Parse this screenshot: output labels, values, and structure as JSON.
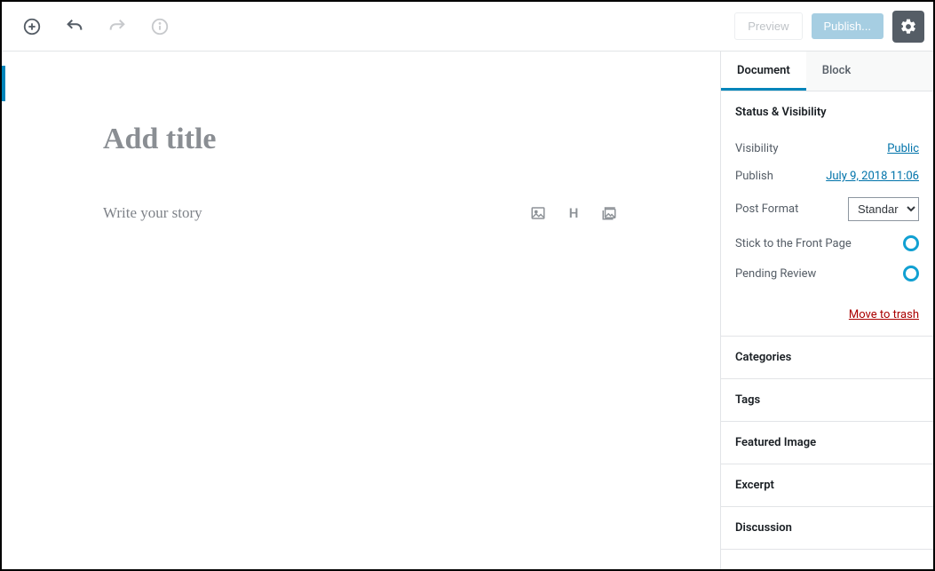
{
  "toolbar": {
    "preview_label": "Preview",
    "publish_label": "Publish..."
  },
  "editor": {
    "title_placeholder": "Add title",
    "body_placeholder": "Write your story",
    "heading_shortcut": "H"
  },
  "sidebar": {
    "tabs": {
      "document": "Document",
      "block": "Block",
      "active": "document"
    },
    "status_panel": {
      "heading": "Status & Visibility",
      "visibility_label": "Visibility",
      "visibility_value": "Public",
      "publish_label": "Publish",
      "publish_value": "July 9, 2018 11:06",
      "post_format_label": "Post Format",
      "post_format_value": "Standard",
      "stick_label": "Stick to the Front Page",
      "pending_label": "Pending Review",
      "trash_label": "Move to trash"
    },
    "panels": {
      "categories": "Categories",
      "tags": "Tags",
      "featured_image": "Featured Image",
      "excerpt": "Excerpt",
      "discussion": "Discussion"
    }
  }
}
